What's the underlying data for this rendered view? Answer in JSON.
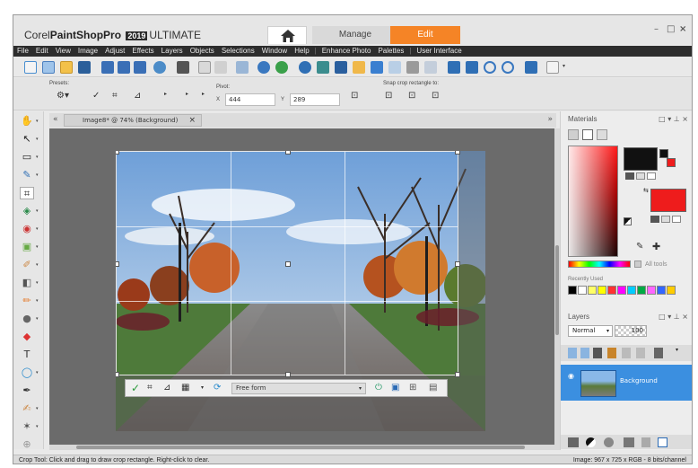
{
  "app": {
    "brand_corel": "Corel",
    "brand_product": "PaintShop",
    "brand_pro": "Pro",
    "brand_year": "2019",
    "brand_edition": "ULTIMATE",
    "tab_manage": "Manage",
    "tab_edit": "Edit",
    "window_controls": [
      "–",
      "□",
      "×"
    ]
  },
  "menu": {
    "items": [
      "File",
      "Edit",
      "View",
      "Image",
      "Adjust",
      "Effects",
      "Layers",
      "Objects",
      "Selections",
      "Window",
      "Help",
      "Enhance Photo",
      "Palettes",
      "User Interface"
    ]
  },
  "options_bar": {
    "presets_label": "Presets:",
    "pivot_label": "Pivot:",
    "x_label": "X",
    "x_value": "444",
    "y_label": "Y",
    "y_value": "289",
    "snap_label": "Snap crop rectangle to:"
  },
  "document": {
    "tab_title": "Image8* @  74% (Background)",
    "tab_close": "×",
    "crop_mode": "Free form"
  },
  "materials": {
    "title": "Materials",
    "all_tools_label": "All tools",
    "recently_used_label": "Recently Used",
    "foreground_color": "#111111",
    "background_color": "#ee1c1c",
    "recent_colors": [
      "#000000",
      "#ffffff",
      "#ffff66",
      "#ffff00",
      "#ff3333",
      "#ff00ff",
      "#00ccff",
      "#00aa44",
      "#ff66ff",
      "#3366ff",
      "#ffcc00"
    ]
  },
  "layers": {
    "title": "Layers",
    "blend_mode": "Normal",
    "opacity": "100",
    "layer_name": "Background",
    "selection_color": "#3b8fe0"
  },
  "status": {
    "left": "Crop Tool: Click and drag to draw crop rectangle. Right-click to clear.",
    "right": "Image:  967 x 725 x RGB - 8 bits/channel"
  },
  "panel_controls": [
    "□",
    "▾",
    "⊥",
    "×"
  ],
  "colors": {
    "accent": "#f58426",
    "menubar": "#2d2d2d",
    "canvas_bg": "#6b6b6b"
  }
}
